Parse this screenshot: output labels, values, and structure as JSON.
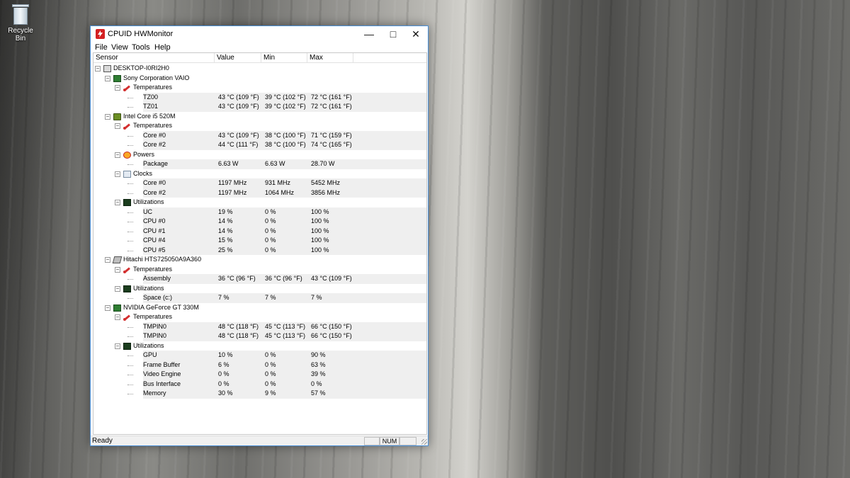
{
  "desktop": {
    "recycle_bin_label": "Recycle Bin"
  },
  "window": {
    "title": "CPUID HWMonitor",
    "controls": {
      "minimize": "—",
      "maximize": "□",
      "close": "✕"
    }
  },
  "menu": [
    "File",
    "View",
    "Tools",
    "Help"
  ],
  "columns": [
    "Sensor",
    "Value",
    "Min",
    "Max"
  ],
  "rows": [
    {
      "level": 0,
      "icon": "computer-icon",
      "expander": "−",
      "name": "DESKTOP-I0RI2H0",
      "value": "",
      "min": "",
      "max": ""
    },
    {
      "level": 1,
      "icon": "motherboard-icon",
      "expander": "−",
      "name": "Sony Corporation VAIO",
      "value": "",
      "min": "",
      "max": ""
    },
    {
      "level": 2,
      "icon": "thermometer-icon",
      "expander": "−",
      "name": "Temperatures",
      "value": "",
      "min": "",
      "max": ""
    },
    {
      "level": 3,
      "icon": "",
      "expander": "",
      "name": "TZ00",
      "value": "43 °C  (109 °F)",
      "min": "39 °C  (102 °F)",
      "max": "72 °C  (161 °F)"
    },
    {
      "level": 3,
      "icon": "",
      "expander": "",
      "name": "TZ01",
      "value": "43 °C  (109 °F)",
      "min": "39 °C  (102 °F)",
      "max": "72 °C  (161 °F)"
    },
    {
      "level": 1,
      "icon": "processor-icon",
      "expander": "−",
      "name": "Intel Core i5 520M",
      "value": "",
      "min": "",
      "max": ""
    },
    {
      "level": 2,
      "icon": "thermometer-icon",
      "expander": "−",
      "name": "Temperatures",
      "value": "",
      "min": "",
      "max": ""
    },
    {
      "level": 3,
      "icon": "",
      "expander": "",
      "name": "Core #0",
      "value": "43 °C  (109 °F)",
      "min": "38 °C  (100 °F)",
      "max": "71 °C  (159 °F)"
    },
    {
      "level": 3,
      "icon": "",
      "expander": "",
      "name": "Core #2",
      "value": "44 °C  (111 °F)",
      "min": "38 °C  (100 °F)",
      "max": "74 °C  (165 °F)"
    },
    {
      "level": 2,
      "icon": "power-icon",
      "expander": "−",
      "name": "Powers",
      "value": "",
      "min": "",
      "max": ""
    },
    {
      "level": 3,
      "icon": "",
      "expander": "",
      "name": "Package",
      "value": "6.63 W",
      "min": "6.63 W",
      "max": "28.70 W"
    },
    {
      "level": 2,
      "icon": "clock-icon",
      "expander": "−",
      "name": "Clocks",
      "value": "",
      "min": "",
      "max": ""
    },
    {
      "level": 3,
      "icon": "",
      "expander": "",
      "name": "Core #0",
      "value": "1197 MHz",
      "min": "931 MHz",
      "max": "5452 MHz"
    },
    {
      "level": 3,
      "icon": "",
      "expander": "",
      "name": "Core #2",
      "value": "1197 MHz",
      "min": "1064 MHz",
      "max": "3856 MHz"
    },
    {
      "level": 2,
      "icon": "utilization-icon",
      "expander": "−",
      "name": "Utilizations",
      "value": "",
      "min": "",
      "max": ""
    },
    {
      "level": 3,
      "icon": "",
      "expander": "",
      "name": "UC",
      "value": "19 %",
      "min": "0 %",
      "max": "100 %"
    },
    {
      "level": 3,
      "icon": "",
      "expander": "",
      "name": "CPU #0",
      "value": "14 %",
      "min": "0 %",
      "max": "100 %"
    },
    {
      "level": 3,
      "icon": "",
      "expander": "",
      "name": "CPU #1",
      "value": "14 %",
      "min": "0 %",
      "max": "100 %"
    },
    {
      "level": 3,
      "icon": "",
      "expander": "",
      "name": "CPU #4",
      "value": "15 %",
      "min": "0 %",
      "max": "100 %"
    },
    {
      "level": 3,
      "icon": "",
      "expander": "",
      "name": "CPU #5",
      "value": "25 %",
      "min": "0 %",
      "max": "100 %"
    },
    {
      "level": 1,
      "icon": "hard-drive-icon",
      "expander": "−",
      "name": "Hitachi HTS725050A9A360",
      "value": "",
      "min": "",
      "max": ""
    },
    {
      "level": 2,
      "icon": "thermometer-icon",
      "expander": "−",
      "name": "Temperatures",
      "value": "",
      "min": "",
      "max": ""
    },
    {
      "level": 3,
      "icon": "",
      "expander": "",
      "name": "Assembly",
      "value": "36 °C  (96 °F)",
      "min": "36 °C  (96 °F)",
      "max": "43 °C  (109 °F)"
    },
    {
      "level": 2,
      "icon": "utilization-icon",
      "expander": "−",
      "name": "Utilizations",
      "value": "",
      "min": "",
      "max": ""
    },
    {
      "level": 3,
      "icon": "",
      "expander": "",
      "name": "Space (c:)",
      "value": "7 %",
      "min": "7 %",
      "max": "7 %"
    },
    {
      "level": 1,
      "icon": "graphics-card-icon",
      "expander": "−",
      "name": "NVIDIA GeForce GT 330M",
      "value": "",
      "min": "",
      "max": ""
    },
    {
      "level": 2,
      "icon": "thermometer-icon",
      "expander": "−",
      "name": "Temperatures",
      "value": "",
      "min": "",
      "max": ""
    },
    {
      "level": 3,
      "icon": "",
      "expander": "",
      "name": "TMPIN0",
      "value": "48 °C  (118 °F)",
      "min": "45 °C  (113 °F)",
      "max": "66 °C  (150 °F)"
    },
    {
      "level": 3,
      "icon": "",
      "expander": "",
      "name": "TMPIN0",
      "value": "48 °C  (118 °F)",
      "min": "45 °C  (113 °F)",
      "max": "66 °C  (150 °F)"
    },
    {
      "level": 2,
      "icon": "utilization-icon",
      "expander": "−",
      "name": "Utilizations",
      "value": "",
      "min": "",
      "max": ""
    },
    {
      "level": 3,
      "icon": "",
      "expander": "",
      "name": "GPU",
      "value": "10 %",
      "min": "0 %",
      "max": "90 %"
    },
    {
      "level": 3,
      "icon": "",
      "expander": "",
      "name": "Frame Buffer",
      "value": "6 %",
      "min": "0 %",
      "max": "63 %"
    },
    {
      "level": 3,
      "icon": "",
      "expander": "",
      "name": "Video Engine",
      "value": "0 %",
      "min": "0 %",
      "max": "39 %"
    },
    {
      "level": 3,
      "icon": "",
      "expander": "",
      "name": "Bus Interface",
      "value": "0 %",
      "min": "0 %",
      "max": "0 %"
    },
    {
      "level": 3,
      "icon": "",
      "expander": "",
      "name": "Memory",
      "value": "30 %",
      "min": "9 %",
      "max": "57 %"
    }
  ],
  "status": {
    "text": "Ready",
    "num": "NUM"
  }
}
